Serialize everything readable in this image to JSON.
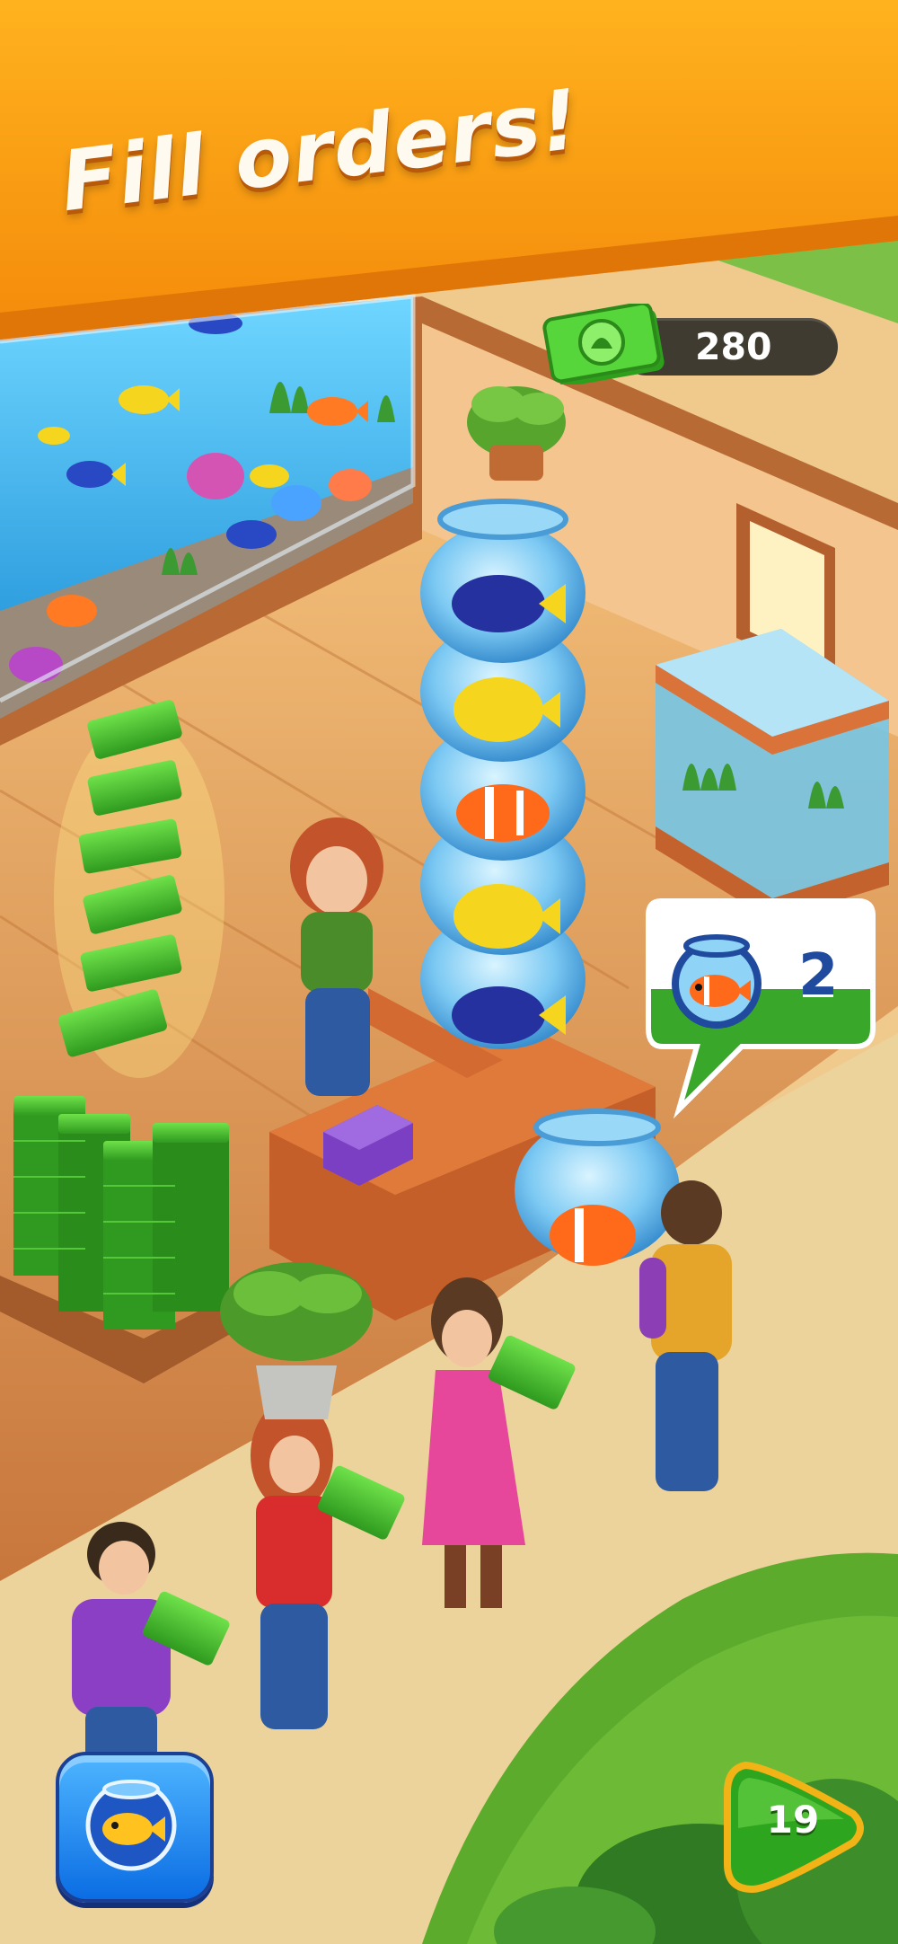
{
  "banner": {
    "title": "Fill orders!"
  },
  "currency": {
    "value": "280",
    "icon": "cash-icon"
  },
  "order_bubble": {
    "item_icon": "fishbowl-clownfish-icon",
    "count": "2"
  },
  "buttons": {
    "fish_button_icon": "fish-icon",
    "level_value": "19"
  },
  "colors": {
    "banner_orange": "#f59b12",
    "cash_green": "#3fbf2a",
    "accent_blue": "#1a6fe0",
    "play_green": "#2da51f",
    "play_border": "#f2b316"
  }
}
